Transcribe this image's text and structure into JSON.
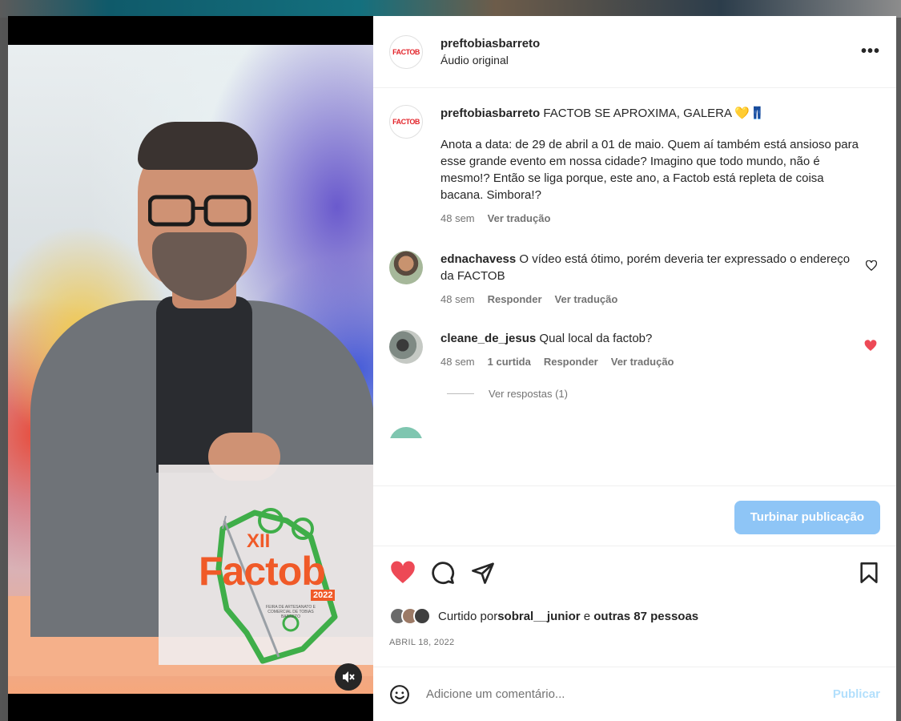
{
  "post": {
    "author": "preftobiasbarreto",
    "audio": "Áudio original",
    "more_label": "•••",
    "avatar_text": "FACTOB"
  },
  "video": {
    "logo_number": "XII",
    "logo_name": "Factob",
    "logo_year": "2022",
    "logo_subtitle": "FEIRA DE ARTESANATO E COMERCIAL DE TOBIAS BARRETO",
    "mute_icon": "speaker-muted-icon"
  },
  "caption": {
    "username": "preftobiasbarreto",
    "headline": "FACTOB SE APROXIMA, GALERA 💛👖",
    "body": "Anota a data: de 29 de abril a 01 de maio. Quem aí também está ansioso para esse grande evento em nossa cidade? Imagino que todo mundo, não é mesmo!? Então se liga porque, este ano, a Factob está repleta de coisa bacana. Simbora!?",
    "time": "48 sem",
    "translate": "Ver tradução"
  },
  "comments": [
    {
      "username": "ednachavess",
      "text": "O vídeo está ótimo, porém deveria ter expressado o endereço da FACTOB",
      "time": "48 sem",
      "reply": "Responder",
      "translate": "Ver tradução",
      "liked": false
    },
    {
      "username": "cleane_de_jesus",
      "text": "Qual local da factob?",
      "time": "48 sem",
      "likes": "1 curtida",
      "reply": "Responder",
      "translate": "Ver tradução",
      "liked": true,
      "view_replies": "Ver respostas (1)"
    }
  ],
  "boost_label": "Turbinar publicação",
  "likes": {
    "prefix": "Curtido por ",
    "user": "sobral__junior",
    "middle": " e ",
    "others": "outras 87 pessoas"
  },
  "date": "ABRIL 18, 2022",
  "comment_box": {
    "placeholder": "Adicione um comentário...",
    "publish": "Publicar"
  },
  "colors": {
    "heart": "#ed4956",
    "boost": "#8ec5f6",
    "publish": "#b2dffc",
    "logo_orange": "#f05a28",
    "logo_green": "#3fae49"
  }
}
